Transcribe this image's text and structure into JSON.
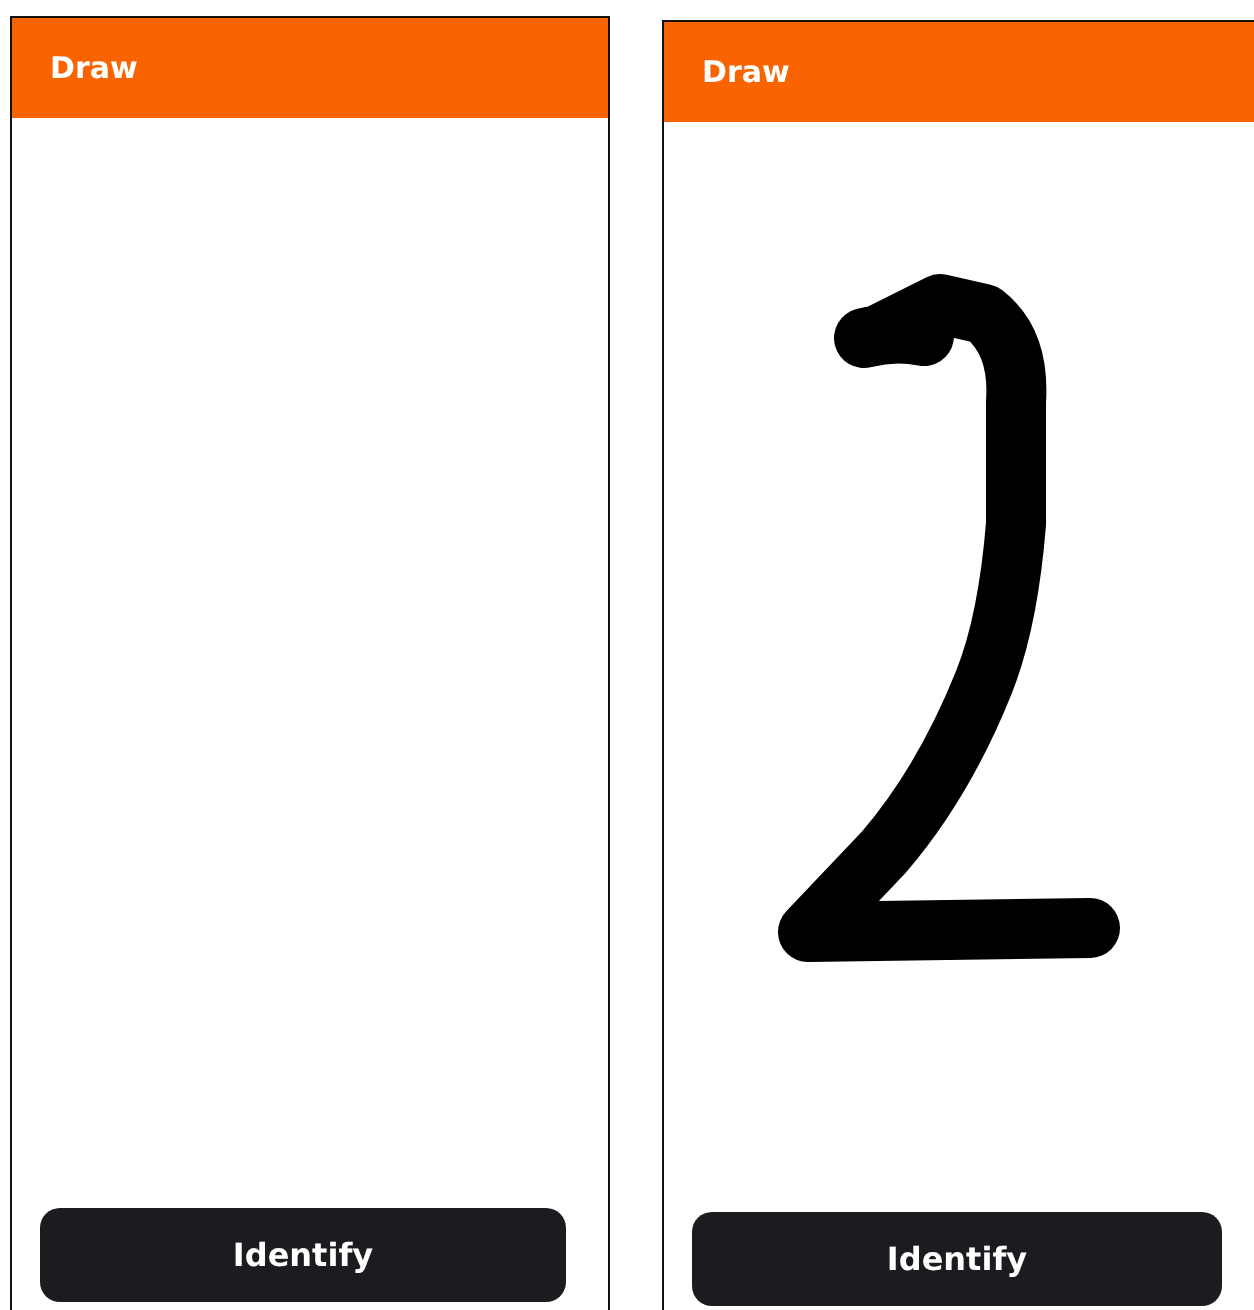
{
  "screens": [
    {
      "title": "Draw",
      "canvas": {
        "kind": "empty"
      },
      "button": "Identify"
    },
    {
      "title": "Draw",
      "canvas": {
        "kind": "drawn"
      },
      "button": "Identify"
    }
  ]
}
